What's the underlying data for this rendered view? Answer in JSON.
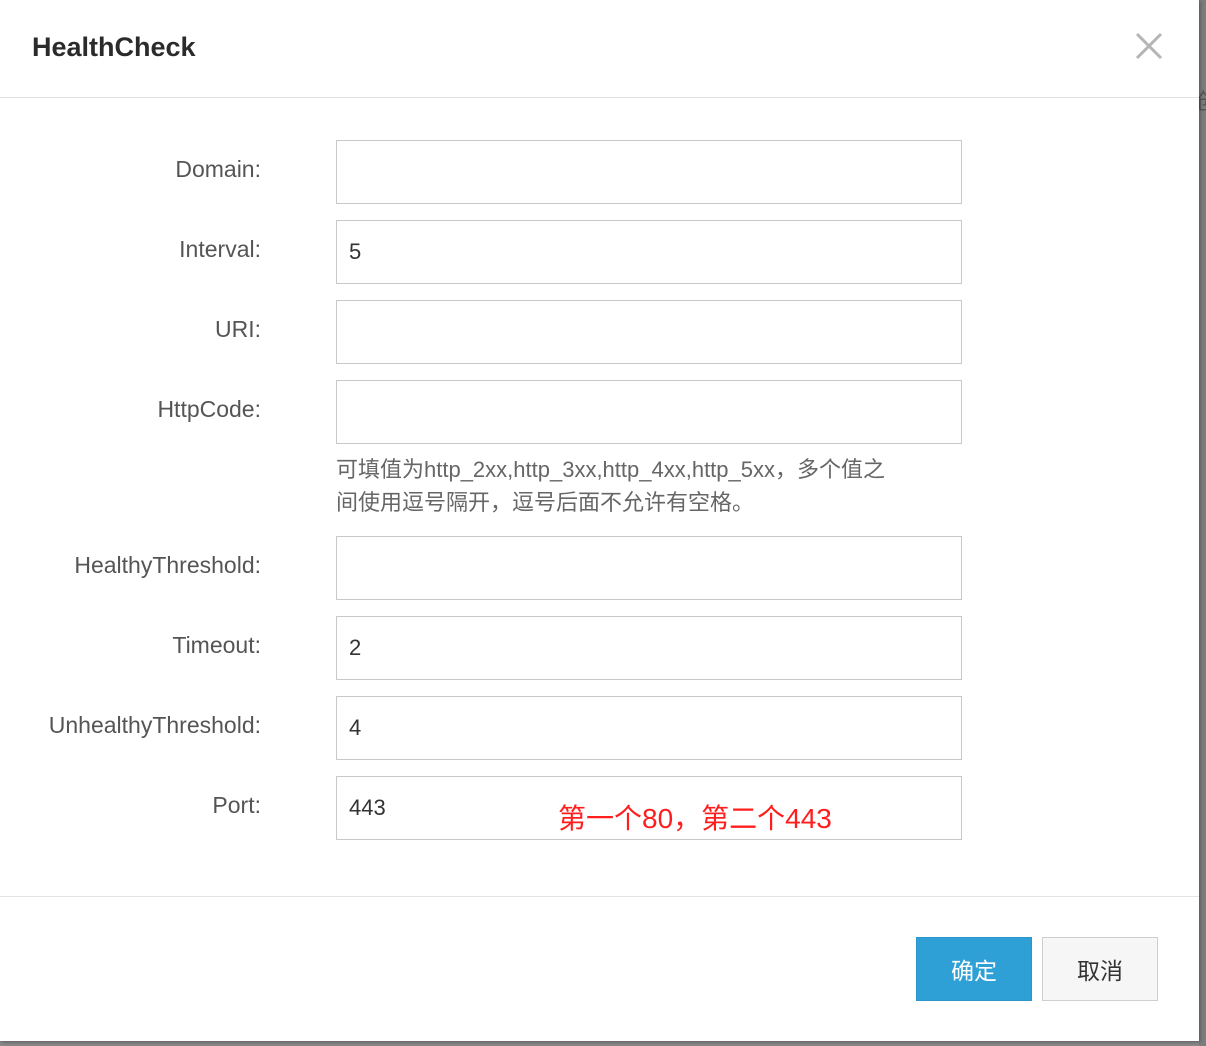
{
  "dialog": {
    "title": "HealthCheck",
    "close_icon": "close-icon"
  },
  "form": {
    "fields": [
      {
        "key": "domain",
        "label": "Domain:",
        "value": ""
      },
      {
        "key": "interval",
        "label": "Interval:",
        "value": "5"
      },
      {
        "key": "uri",
        "label": "URI:",
        "value": ""
      },
      {
        "key": "httpcode",
        "label": "HttpCode:",
        "value": ""
      },
      {
        "key": "healthy_threshold",
        "label": "HealthyThreshold:",
        "value": ""
      },
      {
        "key": "timeout",
        "label": "Timeout:",
        "value": "2"
      },
      {
        "key": "unhealthy_threshold",
        "label": "UnhealthyThreshold:",
        "value": "4"
      },
      {
        "key": "port",
        "label": "Port:",
        "value": "443"
      }
    ],
    "httpcode_help_line1": "可填值为http_2xx,http_3xx,http_4xx,http_5xx，多个值之",
    "httpcode_help_line2": "间使用逗号隔开，逗号后面不允许有空格。",
    "port_annotation": "第一个80，第二个443"
  },
  "footer": {
    "confirm_label": "确定",
    "cancel_label": "取消"
  },
  "background": {
    "partial_glyph": "创"
  },
  "colors": {
    "primary": "#2ea0d6",
    "annotation": "#ff1e1e"
  }
}
